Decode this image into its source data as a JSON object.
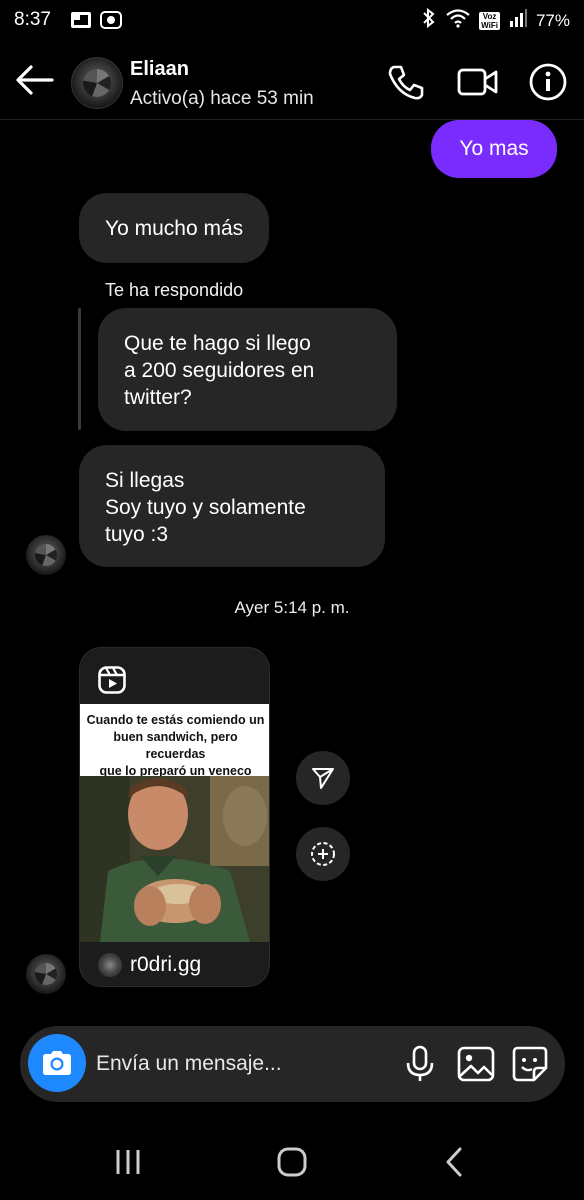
{
  "status_bar": {
    "time": "8:37",
    "battery": "77%",
    "voz_wifi_label_top": "Voz",
    "voz_wifi_label_bottom": "WiFi"
  },
  "header": {
    "contact_name": "Eliaan",
    "contact_status": "Activo(a) hace 53 min",
    "icons": [
      "back-arrow-icon",
      "phone-icon",
      "video-camera-icon",
      "info-icon"
    ]
  },
  "messages": {
    "outgoing_1": "Yo mas",
    "incoming_1": "Yo mucho más",
    "reply_label": "Te ha respondido",
    "quoted_line_1": "Que te hago si llego",
    "quoted_line_2": "a 200  seguidores en",
    "quoted_line_3": "twitter?",
    "incoming_2_line_1": "Si llegas",
    "incoming_2_line_2": "Soy tuyo y solamente",
    "incoming_2_line_3": "tuyo :3",
    "timestamp": "Ayer 5:14 p. m."
  },
  "reel": {
    "caption_line_1": "Cuando te estás comiendo un",
    "caption_line_2": "buen sandwich, pero recuerdas",
    "caption_line_3": "que lo preparó un veneco",
    "username": "r0dri.gg"
  },
  "composer": {
    "placeholder": "Envía un mensaje..."
  },
  "colors": {
    "outgoing_bubble": "#7a2cff",
    "incoming_bubble": "#262626",
    "camera_button": "#1e88ff",
    "background": "#000000"
  }
}
